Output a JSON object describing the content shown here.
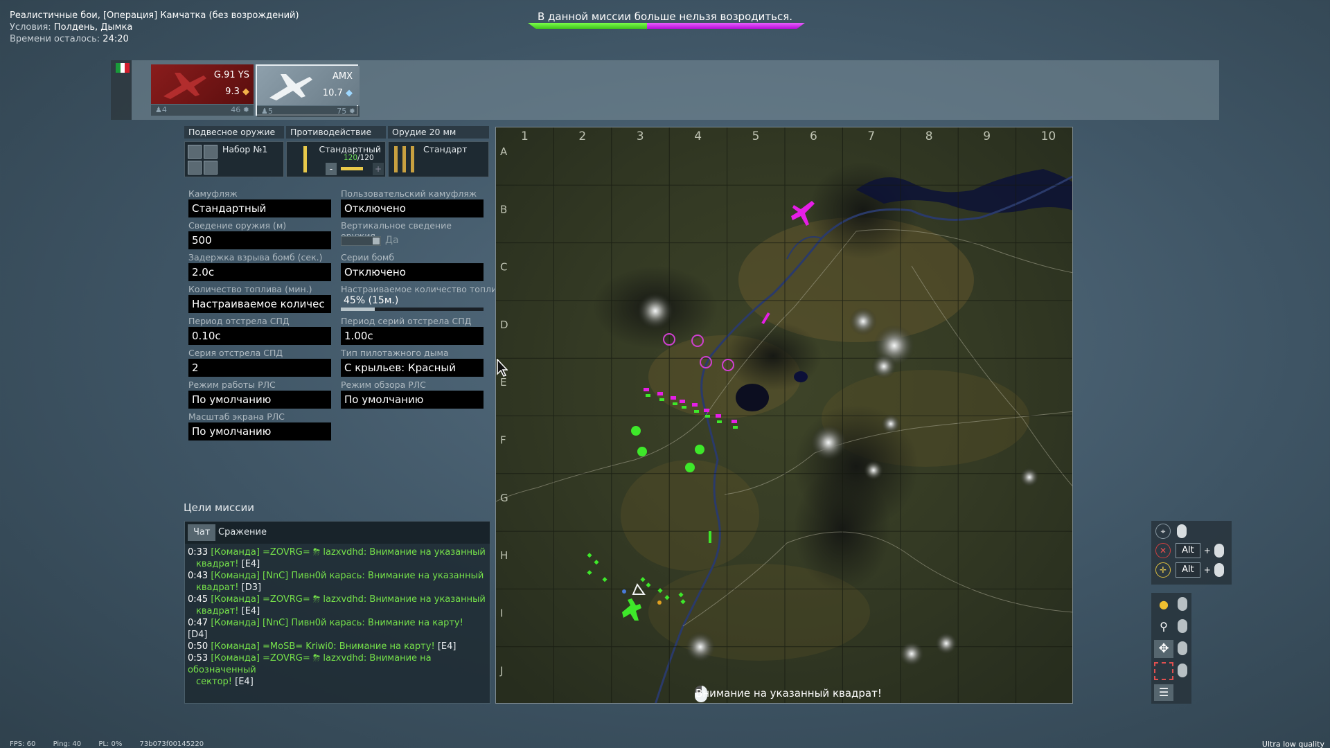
{
  "header": {
    "mode": "Реалистичные бои, [Операция] Камчатка (без возрождений)",
    "conditions_label": "Условия:",
    "conditions_value": "Полдень, Дымка",
    "time_label": "Времени осталось:",
    "time_value": "24:20"
  },
  "top_notice": "В данной миссии больше нельзя возродиться.",
  "team_score": {
    "green_fraction": 0.43,
    "purple_fraction": 0.57,
    "colors": {
      "green": "#5de02f",
      "purple": "#c31ee6"
    }
  },
  "nation_flag": {
    "colors": [
      "#1a9a3a",
      "#ffffff",
      "#d21e2c"
    ]
  },
  "vehicles": [
    {
      "name": "G.91 YS",
      "br": "9.3",
      "crew": "4",
      "rp": "46",
      "state": "destroyed",
      "icon": "jet-icon",
      "color": "#8a1c1c"
    },
    {
      "name": "AMX",
      "br": "10.7",
      "crew": "5",
      "rp": "75",
      "state": "selected",
      "icon": "jet-icon",
      "color": "#e8eef2"
    }
  ],
  "weapons": {
    "tabs": [
      "Подвесное оружие",
      "Противодействие",
      "Орудие 20 мм"
    ],
    "suspended": "Набор №1",
    "countermeasures": {
      "name": "Стандартный",
      "count": "120",
      "max": "/120",
      "minus": "-",
      "plus": "+"
    },
    "cannon": "Стандарт"
  },
  "settings": [
    {
      "label": "Камуфляж",
      "value": "Стандартный"
    },
    {
      "label": "Пользовательский камуфляж",
      "value": "Отключено"
    },
    {
      "label": "Сведение оружия (м)",
      "value": "500"
    },
    {
      "label": "Вертикальное сведение оружия",
      "value": "Да"
    },
    {
      "label": "Задержка взрыва бомб (сек.)",
      "value": "2.0с"
    },
    {
      "label": "Серии бомб",
      "value": "Отключено"
    },
    {
      "label": "Количество топлива (мин.)",
      "value": "Настраиваемое количес"
    },
    {
      "label": "Настраиваемое количество топлива",
      "value": "45% (15м.)"
    },
    {
      "label": "Период отстрела СПД",
      "value": "0.10с"
    },
    {
      "label": "Период серий отстрела СПД",
      "value": "1.00с"
    },
    {
      "label": "Серия отстрела СПД",
      "value": "2"
    },
    {
      "label": "Тип пилотажного дыма",
      "value": "С крыльев: Красный"
    },
    {
      "label": "Режим работы РЛС",
      "value": "По умолчанию"
    },
    {
      "label": "Режим обзора РЛС",
      "value": "По умолчанию"
    },
    {
      "label": "Масштаб экрана РЛС",
      "value": "По умолчанию"
    }
  ],
  "fuel_fraction": 0.24,
  "mission": {
    "title": "Цели миссии"
  },
  "chat": {
    "tabs": [
      "Чат",
      "Сражение"
    ],
    "messages": [
      {
        "time": "0:33",
        "text": "[Команда] =ZOVRG= ⛈ lazxvdhd: Внимание на указанный",
        "cont": "квадрат!",
        "grid": "[E4]"
      },
      {
        "time": "0:43",
        "text": "[Команда] [NnC] Пивн0й карась: Внимание на указанный",
        "cont": "квадрат!",
        "grid": "[D3]"
      },
      {
        "time": "0:45",
        "text": "[Команда] =ZOVRG= ⛈ lazxvdhd: Внимание на указанный",
        "cont": "квадрат!",
        "grid": "[E4]"
      },
      {
        "time": "0:47",
        "text": "[Команда] [NnC] Пивн0й карась: Внимание на карту!",
        "cont": "",
        "grid": "[D4]"
      },
      {
        "time": "0:50",
        "text": "[Команда] =MoSB= Kriwi0: Внимание на карту!",
        "cont": "",
        "grid": "[E4]"
      },
      {
        "time": "0:53",
        "text": "[Команда] =ZOVRG= ⛈ lazxvdhd: Внимание на обозначенный",
        "cont": "сектор!",
        "grid": "[E4]"
      }
    ]
  },
  "map": {
    "columns": [
      "1",
      "2",
      "3",
      "4",
      "5",
      "6",
      "7",
      "8",
      "9",
      "10"
    ],
    "rows": [
      "A",
      "B",
      "C",
      "D",
      "E",
      "F",
      "G",
      "H",
      "I",
      "J"
    ],
    "caption": "Внимание на указанный квадрат!",
    "allies_color": "#3ee82a",
    "enemy_color": "#e61ee6"
  },
  "controls": {
    "alt1": "Alt",
    "alt2": "Alt",
    "plus": "+"
  },
  "footer": {
    "fps": "FPS: 60",
    "ping": "Ping: 40",
    "pl": "PL: 0%",
    "id": "73b073f00145220",
    "quality": "Ultra low quality"
  }
}
